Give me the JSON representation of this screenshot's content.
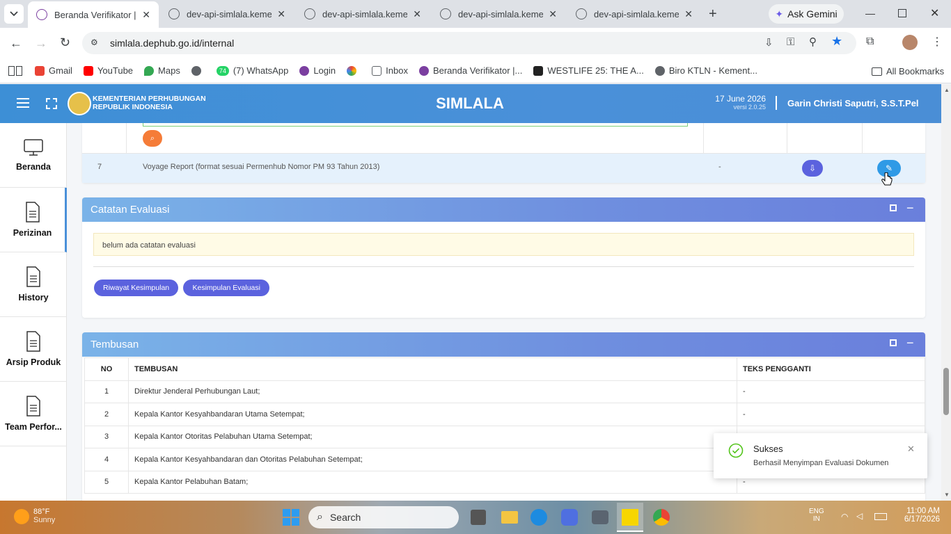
{
  "browser": {
    "tabs": [
      {
        "title": "Beranda Verifikator | Si",
        "active": true
      },
      {
        "title": "dev-api-simlala.kemenh",
        "active": false
      },
      {
        "title": "dev-api-simlala.kemenh",
        "active": false
      },
      {
        "title": "dev-api-simlala.kemenh",
        "active": false
      },
      {
        "title": "dev-api-simlala.kemenh",
        "active": false
      }
    ],
    "ask_gemini": "Ask Gemini",
    "url": "simlala.dephub.go.id/internal",
    "bookmarks": [
      {
        "label": "Gmail",
        "color": "#ea4335"
      },
      {
        "label": "YouTube",
        "color": "#ff0000"
      },
      {
        "label": "Maps",
        "color": "#34a853"
      },
      {
        "label": "",
        "color": "#5f6368"
      },
      {
        "label": "(7) WhatsApp",
        "color": "#25d366",
        "badge": "74"
      },
      {
        "label": "Login",
        "color": "#7b3fa0"
      },
      {
        "label": "",
        "color": "#fbbc04"
      },
      {
        "label": "Inbox",
        "color": "#5f6368"
      },
      {
        "label": "Beranda Verifikator |...",
        "color": "#7b3fa0"
      },
      {
        "label": "WESTLIFE 25: THE A...",
        "color": "#222222"
      },
      {
        "label": "Biro KTLN - Kement...",
        "color": "#5f6368"
      }
    ],
    "all_bookmarks": "All Bookmarks"
  },
  "app": {
    "org_line1": "KEMENTERIAN PERHUBUNGAN",
    "org_line2": "REPUBLIK INDONESIA",
    "title": "SIMLALA",
    "date": "17 June 2026",
    "version": "versi 2.0.25",
    "user": "Garin Christi Saputri, S.S.T.Pel"
  },
  "sidebar": [
    {
      "label": "Beranda",
      "icon": "monitor-icon"
    },
    {
      "label": "Perizinan",
      "icon": "document-icon",
      "active": true
    },
    {
      "label": "History",
      "icon": "document-icon"
    },
    {
      "label": "Arsip Produk",
      "icon": "document-icon"
    },
    {
      "label": "Team Perfor...",
      "icon": "document-icon"
    }
  ],
  "documents": {
    "row7": {
      "no": "7",
      "name": "Voyage Report (format sesuai Permenhub Nomor PM 93 Tahun 2013)",
      "value": "-"
    }
  },
  "evaluasi": {
    "title": "Catatan Evaluasi",
    "note": "belum ada catatan evaluasi",
    "btn_riwayat": "Riwayat Kesimpulan",
    "btn_kesimpulan": "Kesimpulan Evaluasi"
  },
  "tembusan": {
    "title": "Tembusan",
    "headers": [
      "NO",
      "TEMBUSAN",
      "TEKS PENGGANTI"
    ],
    "rows": [
      {
        "no": "1",
        "name": "Direktur Jenderal Perhubungan Laut;",
        "teks": "-"
      },
      {
        "no": "2",
        "name": "Kepala Kantor Kesyahbandaran Utama Setempat;",
        "teks": "-"
      },
      {
        "no": "3",
        "name": "Kepala Kantor Otoritas Pelabuhan Utama Setempat;",
        "teks": ""
      },
      {
        "no": "4",
        "name": "Kepala Kantor Kesyahbandaran dan Otoritas Pelabuhan Setempat;",
        "teks": ""
      },
      {
        "no": "5",
        "name": "Kepala Kantor Pelabuhan Batam;",
        "teks": "-"
      }
    ]
  },
  "toast": {
    "title": "Sukses",
    "message": "Berhasil Menyimpan Evaluasi Dokumen"
  },
  "taskbar": {
    "weather_temp": "88°F",
    "weather_desc": "Sunny",
    "search": "Search",
    "lang1": "ENG",
    "lang2": "IN",
    "time": "11:00 AM",
    "date": "6/17/2026"
  }
}
